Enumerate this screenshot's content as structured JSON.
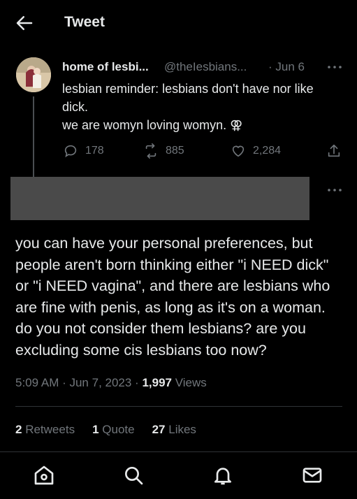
{
  "header": {
    "title": "Tweet"
  },
  "parent_tweet": {
    "name": "home of lesbi...",
    "handle": "@theIesbians...",
    "date": "· Jun 6",
    "lines": [
      "lesbian reminder: lesbians don't have nor like",
      "dick.",
      "we are womyn loving womyn. ⚢"
    ],
    "replies": "178",
    "retweets": "885",
    "likes": "2,284"
  },
  "main_tweet": {
    "lines": [
      "you can have your personal preferences, but",
      "people aren't born thinking either \"i NEED dick\"",
      "or \"i NEED vagina\", and there are lesbians who",
      "are fine with penis, as long as it's on a woman.",
      "do you not consider them lesbians? are you",
      "excluding some cis lesbians too now?"
    ],
    "timestamp": "5:09 AM · Jun 7, 2023 ·",
    "views_count": "1,997",
    "views_label": "Views"
  },
  "stats": {
    "retweets_count": "2",
    "retweets_label": "Retweets",
    "quotes_count": "1",
    "quotes_label": "Quote",
    "likes_count": "27",
    "likes_label": "Likes"
  },
  "icons": {
    "back": "arrow-left-icon",
    "more": "more-icon",
    "reply": "reply-icon",
    "retweet": "retweet-icon",
    "like": "heart-icon",
    "share": "share-icon",
    "home": "home-icon",
    "search": "search-icon",
    "notifications": "bell-icon",
    "messages": "mail-icon"
  }
}
